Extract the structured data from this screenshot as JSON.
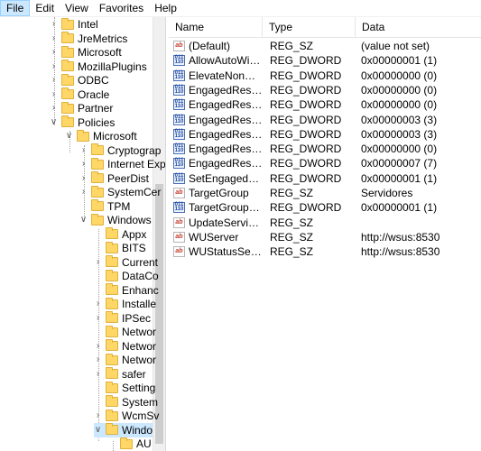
{
  "menu": [
    "File",
    "Edit",
    "View",
    "Favorites",
    "Help"
  ],
  "tree": {
    "nodes": [
      {
        "label": "Intel",
        "expander": ">"
      },
      {
        "label": "JreMetrics",
        "expander": ">"
      },
      {
        "label": "Microsoft",
        "expander": ">"
      },
      {
        "label": "MozillaPlugins",
        "expander": ">"
      },
      {
        "label": "ODBC",
        "expander": ">"
      },
      {
        "label": "Oracle",
        "expander": ">"
      },
      {
        "label": "Partner",
        "expander": ">"
      },
      {
        "label": "Policies",
        "expander": "v"
      },
      {
        "label": "Microsoft",
        "expander": "v"
      },
      {
        "label": "Cryptograp",
        "expander": ">"
      },
      {
        "label": "Internet Exp",
        "expander": ">"
      },
      {
        "label": "PeerDist",
        "expander": ">"
      },
      {
        "label": "SystemCer",
        "expander": ">"
      },
      {
        "label": "TPM",
        "expander": ""
      },
      {
        "label": "Windows",
        "expander": "v"
      },
      {
        "label": "Appx",
        "expander": ""
      },
      {
        "label": "BITS",
        "expander": ""
      },
      {
        "label": "Current",
        "expander": ">"
      },
      {
        "label": "DataCo",
        "expander": ""
      },
      {
        "label": "Enhanc",
        "expander": ""
      },
      {
        "label": "Installe",
        "expander": ">"
      },
      {
        "label": "IPSec",
        "expander": ">"
      },
      {
        "label": "Networ",
        "expander": ""
      },
      {
        "label": "Networ",
        "expander": ">"
      },
      {
        "label": "Networ",
        "expander": ">"
      },
      {
        "label": "safer",
        "expander": ">"
      },
      {
        "label": "Setting",
        "expander": ""
      },
      {
        "label": "System",
        "expander": ""
      },
      {
        "label": "WcmSv",
        "expander": ">"
      },
      {
        "label": "Windo",
        "expander": "v"
      },
      {
        "label": "AU",
        "expander": ""
      }
    ]
  },
  "list": {
    "headers": {
      "name": "Name",
      "type": "Type",
      "data": "Data"
    },
    "rows": [
      {
        "icon": "string-value-icon",
        "name": "(Default)",
        "type": "REG_SZ",
        "data": "(value not set)"
      },
      {
        "icon": "dword-value-icon",
        "name": "AllowAutoWind...",
        "type": "REG_DWORD",
        "data": "0x00000001 (1)"
      },
      {
        "icon": "dword-value-icon",
        "name": "ElevateNonAd...",
        "type": "REG_DWORD",
        "data": "0x00000000 (0)"
      },
      {
        "icon": "dword-value-icon",
        "name": "EngagedRestart...",
        "type": "REG_DWORD",
        "data": "0x00000000 (0)"
      },
      {
        "icon": "dword-value-icon",
        "name": "EngagedRestart...",
        "type": "REG_DWORD",
        "data": "0x00000000 (0)"
      },
      {
        "icon": "dword-value-icon",
        "name": "EngagedRestart...",
        "type": "REG_DWORD",
        "data": "0x00000003 (3)"
      },
      {
        "icon": "dword-value-icon",
        "name": "EngagedRestart...",
        "type": "REG_DWORD",
        "data": "0x00000003 (3)"
      },
      {
        "icon": "dword-value-icon",
        "name": "EngagedRestart...",
        "type": "REG_DWORD",
        "data": "0x00000000 (0)"
      },
      {
        "icon": "dword-value-icon",
        "name": "EngagedRestart...",
        "type": "REG_DWORD",
        "data": "0x00000007 (7)"
      },
      {
        "icon": "dword-value-icon",
        "name": "SetEngagedRest...",
        "type": "REG_DWORD",
        "data": "0x00000001 (1)"
      },
      {
        "icon": "string-value-icon",
        "name": "TargetGroup",
        "type": "REG_SZ",
        "data": "Servidores"
      },
      {
        "icon": "dword-value-icon",
        "name": "TargetGroupEna...",
        "type": "REG_DWORD",
        "data": "0x00000001 (1)"
      },
      {
        "icon": "string-value-icon",
        "name": "UpdateServiceU...",
        "type": "REG_SZ",
        "data": ""
      },
      {
        "icon": "string-value-icon",
        "name": "WUServer",
        "type": "REG_SZ",
        "data": "http://wsus:8530"
      },
      {
        "icon": "string-value-icon",
        "name": "WUStatusServer",
        "type": "REG_SZ",
        "data": "http://wsus:8530"
      }
    ]
  }
}
